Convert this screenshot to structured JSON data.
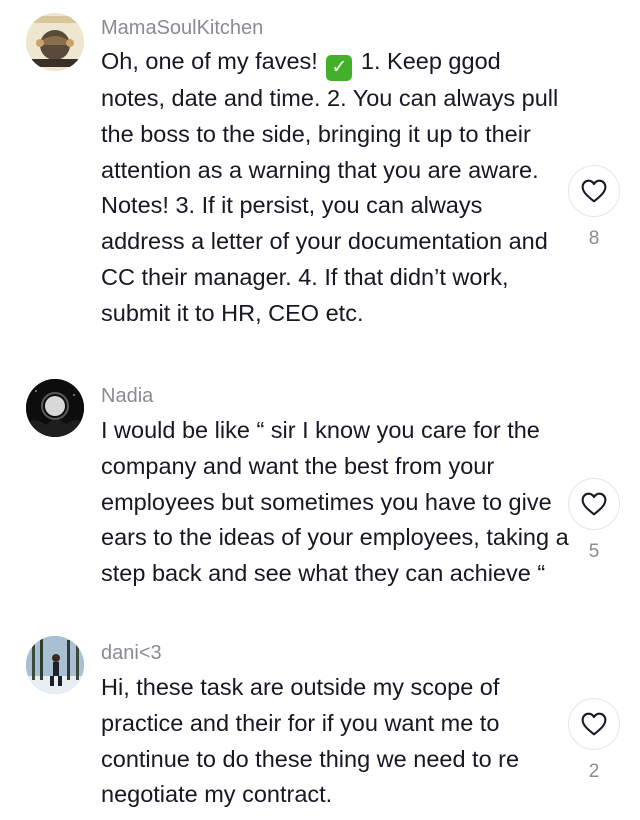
{
  "comments": [
    {
      "username": "MamaSoulKitchen",
      "text_before_icon": "Oh, one of my faves! ",
      "icon": "check-mark-icon",
      "icon_glyph": "✓",
      "icon_color": "#43b02a",
      "text_after_icon": " 1. Keep ggod notes, date and time. 2. You can always pull the boss to the side, bringing it up to their attention as a warning that you are aware. Notes! 3. If it persist, you can always address a letter of your documentation and CC their manager. 4. If that didn’t work, submit it to HR, CEO etc.",
      "likes": "8"
    },
    {
      "username": "Nadia",
      "text": "I would be like “ sir I know you care for the company and want the best from your employees but sometimes you have to give ears to the ideas of your employees, taking a step back and see what they can achieve “",
      "likes": "5"
    },
    {
      "username": "dani<3",
      "text": "Hi, these task are outside my scope of practice and their for if you want me to continue to do these thing we need to re negotiate my contract.",
      "likes": "2"
    }
  ],
  "colors": {
    "text": "#161823",
    "muted": "#8a8b91",
    "like_border": "#e6e6e8"
  }
}
